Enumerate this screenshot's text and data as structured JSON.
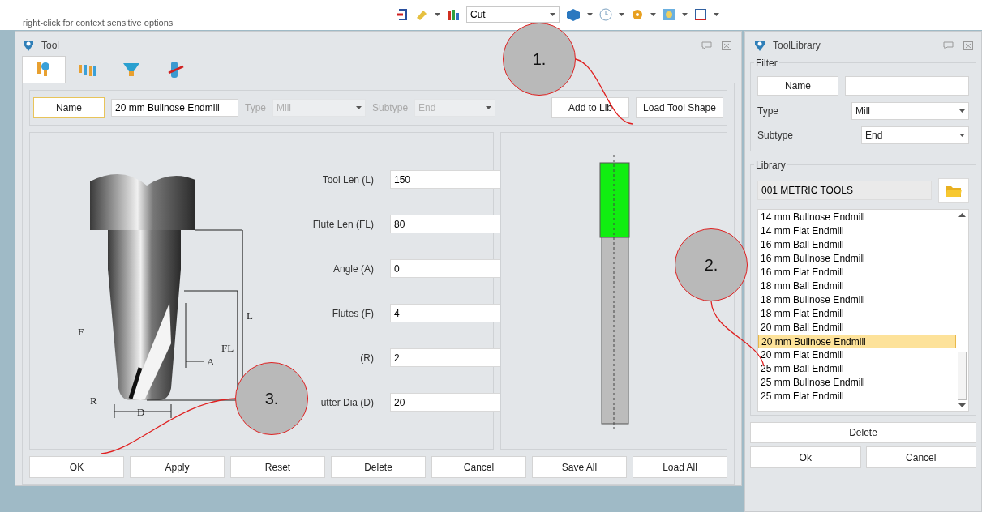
{
  "context_hint": "right-click for context sensitive options",
  "toolbar": {
    "mode_value": "Cut"
  },
  "tool_window": {
    "title": "Tool",
    "tabs": [
      {
        "selected": true
      },
      {
        "selected": false
      },
      {
        "selected": false
      },
      {
        "selected": false
      }
    ],
    "name_button": "Name",
    "name_value": "20 mm Bullnose Endmill",
    "type": {
      "label": "Type",
      "value": "Mill",
      "disabled": true
    },
    "subtype": {
      "label": "Subtype",
      "value": "End",
      "disabled": true
    },
    "header_buttons": [
      "Add to Lib",
      "Load Tool Shape"
    ],
    "diagram_labels": {
      "F": "F",
      "L": "L",
      "FL": "FL",
      "A": "A",
      "R": "R",
      "D": "D"
    },
    "params": [
      {
        "label": "Tool Len (L)",
        "value": "150"
      },
      {
        "label": "Flute Len (FL)",
        "value": "80"
      },
      {
        "label": "Angle (A)",
        "value": "0"
      },
      {
        "label": "Flutes (F)",
        "value": "4"
      },
      {
        "label": "(R)",
        "value": "2"
      },
      {
        "label": "utter Dia (D)",
        "value": "20"
      }
    ],
    "footer_buttons": [
      "OK",
      "Apply",
      "Reset",
      "Delete",
      "Cancel",
      "Save All",
      "Load All"
    ]
  },
  "library_window": {
    "title": "ToolLibrary",
    "filter": {
      "title": "Filter",
      "name_button": "Name",
      "type": {
        "label": "Type",
        "value": "Mill"
      },
      "subtype": {
        "label": "Subtype",
        "value": "End"
      }
    },
    "library": {
      "title": "Library",
      "name": "001 METRIC TOOLS",
      "items": [
        {
          "label": "14 mm Bullnose Endmill",
          "selected": false
        },
        {
          "label": "14 mm Flat Endmill",
          "selected": false
        },
        {
          "label": "16 mm Ball Endmill",
          "selected": false
        },
        {
          "label": "16 mm Bullnose Endmill",
          "selected": false
        },
        {
          "label": "16 mm Flat Endmill",
          "selected": false
        },
        {
          "label": "18 mm Ball Endmill",
          "selected": false
        },
        {
          "label": "18 mm Bullnose Endmill",
          "selected": false
        },
        {
          "label": "18 mm Flat Endmill",
          "selected": false
        },
        {
          "label": "20 mm Ball Endmill",
          "selected": false
        },
        {
          "label": "20 mm Bullnose Endmill",
          "selected": true
        },
        {
          "label": "20 mm Flat Endmill",
          "selected": false
        },
        {
          "label": "25 mm Ball Endmill",
          "selected": false
        },
        {
          "label": "25 mm Bullnose Endmill",
          "selected": false
        },
        {
          "label": "25 mm Flat Endmill",
          "selected": false
        }
      ]
    },
    "delete_button": "Delete",
    "ok_button": "Ok",
    "cancel_button": "Cancel"
  },
  "callouts": [
    "1.",
    "2.",
    "3."
  ]
}
